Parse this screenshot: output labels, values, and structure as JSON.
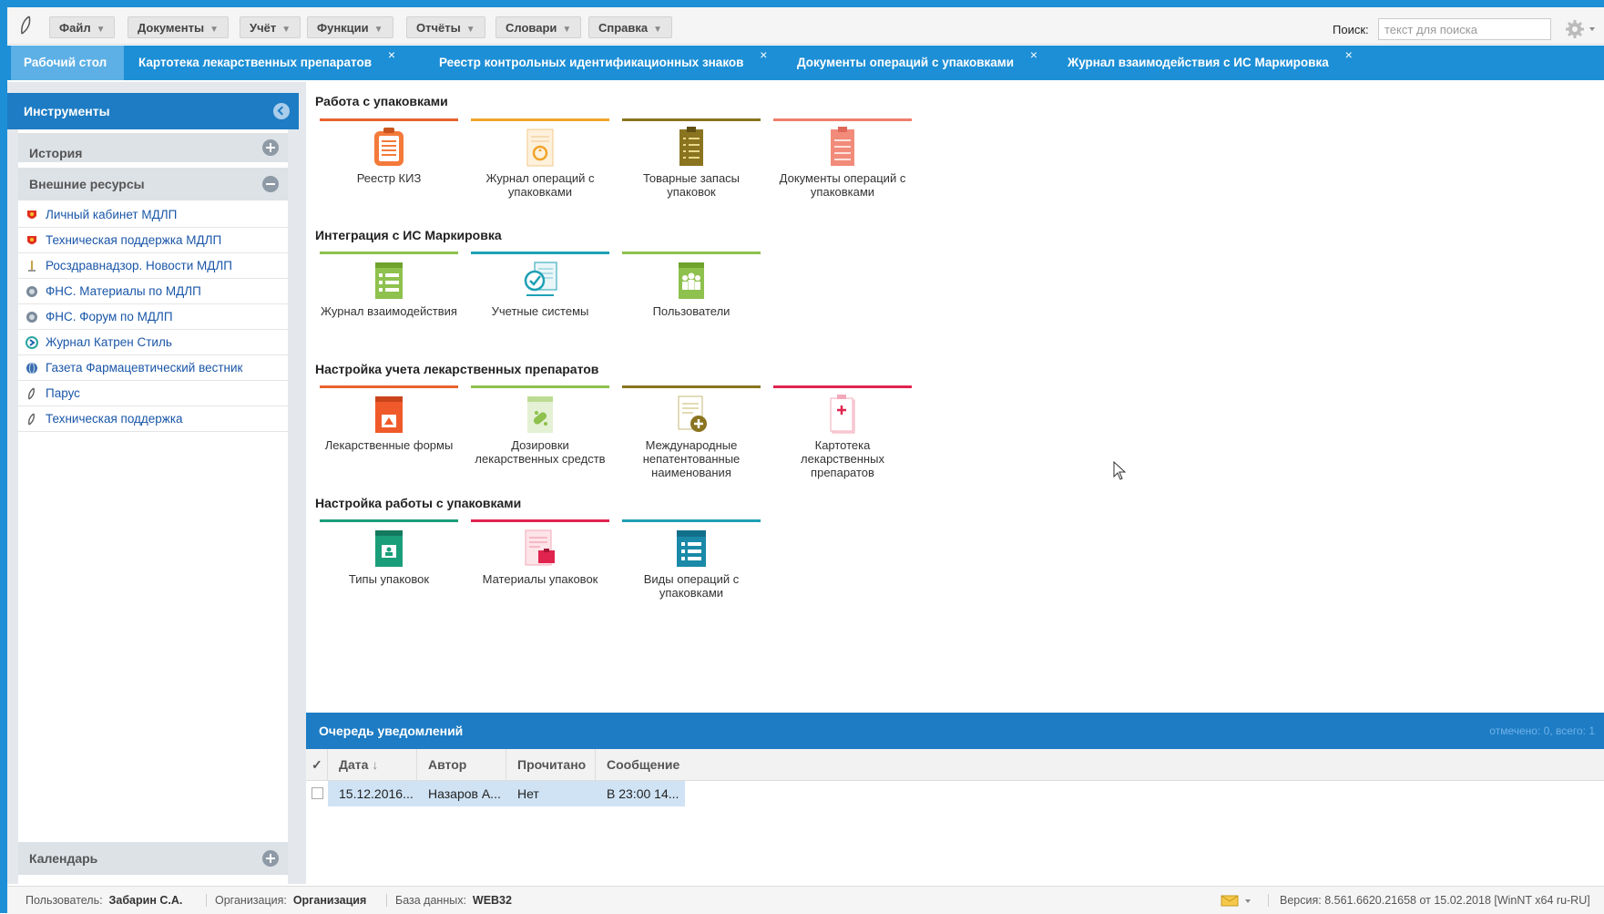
{
  "menubar": {
    "items": [
      "Файл",
      "Документы",
      "Учёт",
      "Функции",
      "Отчёты",
      "Словари",
      "Справка"
    ],
    "search_label": "Поиск:",
    "search_placeholder": "текст для поиска"
  },
  "tabs": [
    {
      "label": "Рабочий стол",
      "active": true
    },
    {
      "label": "Картотека лекарственных препаратов"
    },
    {
      "label": "Реестр контрольных идентификационных знаков"
    },
    {
      "label": "Документы операций с упаковками"
    },
    {
      "label": "Журнал взаимодействия с ИС Маркировка"
    }
  ],
  "sidebar": {
    "title": "Инструменты",
    "history_label": "История",
    "external_label": "Внешние ресурсы",
    "calendar_label": "Календарь",
    "links": [
      {
        "label": "Личный кабинет МДЛП",
        "icon": "emblem-icon"
      },
      {
        "label": "Техническая поддержка МДЛП",
        "icon": "emblem-icon"
      },
      {
        "label": "Росздравнадзор. Новости МДЛП",
        "icon": "roszdrav-icon"
      },
      {
        "label": "ФНС. Материалы по МДЛП",
        "icon": "fns-icon"
      },
      {
        "label": "ФНС. Форум по МДЛП",
        "icon": "fns-icon"
      },
      {
        "label": "Журнал Катрен Стиль",
        "icon": "katren-icon"
      },
      {
        "label": "Газета Фармацевтический вестник",
        "icon": "globe-icon"
      },
      {
        "label": "Парус",
        "icon": "parus-icon"
      },
      {
        "label": "Техническая поддержка",
        "icon": "parus-icon"
      }
    ]
  },
  "groups": [
    {
      "title": "Работа с упаковками",
      "tiles": [
        {
          "label": "Реестр КИЗ",
          "color": "#e8632d",
          "icon": "registry-icon"
        },
        {
          "label": "Журнал операций с упаковками",
          "color": "#f0a42b",
          "icon": "journal-icon"
        },
        {
          "label": "Товарные запасы упаковок",
          "color": "#8a7420",
          "icon": "stock-icon"
        },
        {
          "label": "Документы операций с упаковками",
          "color": "#f07e6e",
          "icon": "documents-icon"
        }
      ]
    },
    {
      "title": "Интеграция с ИС Маркировка",
      "tiles": [
        {
          "label": "Журнал взаимодействия",
          "color": "#8ec14d",
          "icon": "interaction-journal-icon"
        },
        {
          "label": "Учетные системы",
          "color": "#1ea0b5",
          "icon": "accounting-systems-icon"
        },
        {
          "label": "Пользователи",
          "color": "#8ec14d",
          "icon": "users-icon"
        }
      ]
    },
    {
      "title": "Настройка учета лекарственных препаратов",
      "tiles": [
        {
          "label": "Лекарственные формы",
          "color": "#e8632d",
          "icon": "dosage-forms-icon"
        },
        {
          "label": "Дозировки лекарственных средств",
          "color": "#8ec14d",
          "icon": "dosages-icon"
        },
        {
          "label": "Международные непатентованные наименования",
          "color": "#8a7420",
          "icon": "inn-icon"
        },
        {
          "label": "Картотека лекарственных препаратов",
          "color": "#e0244e",
          "icon": "drug-catalog-icon"
        }
      ]
    },
    {
      "title": "Настройка работы с упаковками",
      "tiles": [
        {
          "label": "Типы упаковок",
          "color": "#1a9e7a",
          "icon": "package-types-icon"
        },
        {
          "label": "Материалы упаковок",
          "color": "#e0244e",
          "icon": "package-materials-icon"
        },
        {
          "label": "Виды операций с упаковками",
          "color": "#1ea0b5",
          "icon": "operation-types-icon"
        }
      ]
    }
  ],
  "notifications": {
    "title": "Очередь уведомлений",
    "count": "отмечено: 0, всего: 1",
    "check_header": "✓",
    "columns": [
      "Дата",
      "Автор",
      "Прочитано",
      "Сообщение"
    ],
    "rows": [
      {
        "date": "15.12.2016...",
        "author": "Назаров А...",
        "read": "Нет",
        "message": "В 23:00 14..."
      }
    ]
  },
  "status": {
    "user_label": "Пользователь:",
    "user": "Забарин С.А.",
    "org_label": "Организация:",
    "org": "Организация",
    "db_label": "База данных:",
    "db": "WEB32",
    "version": "Версия: 8.561.6620.21658 от 15.02.2018 [WinNT x64 ru-RU]"
  }
}
